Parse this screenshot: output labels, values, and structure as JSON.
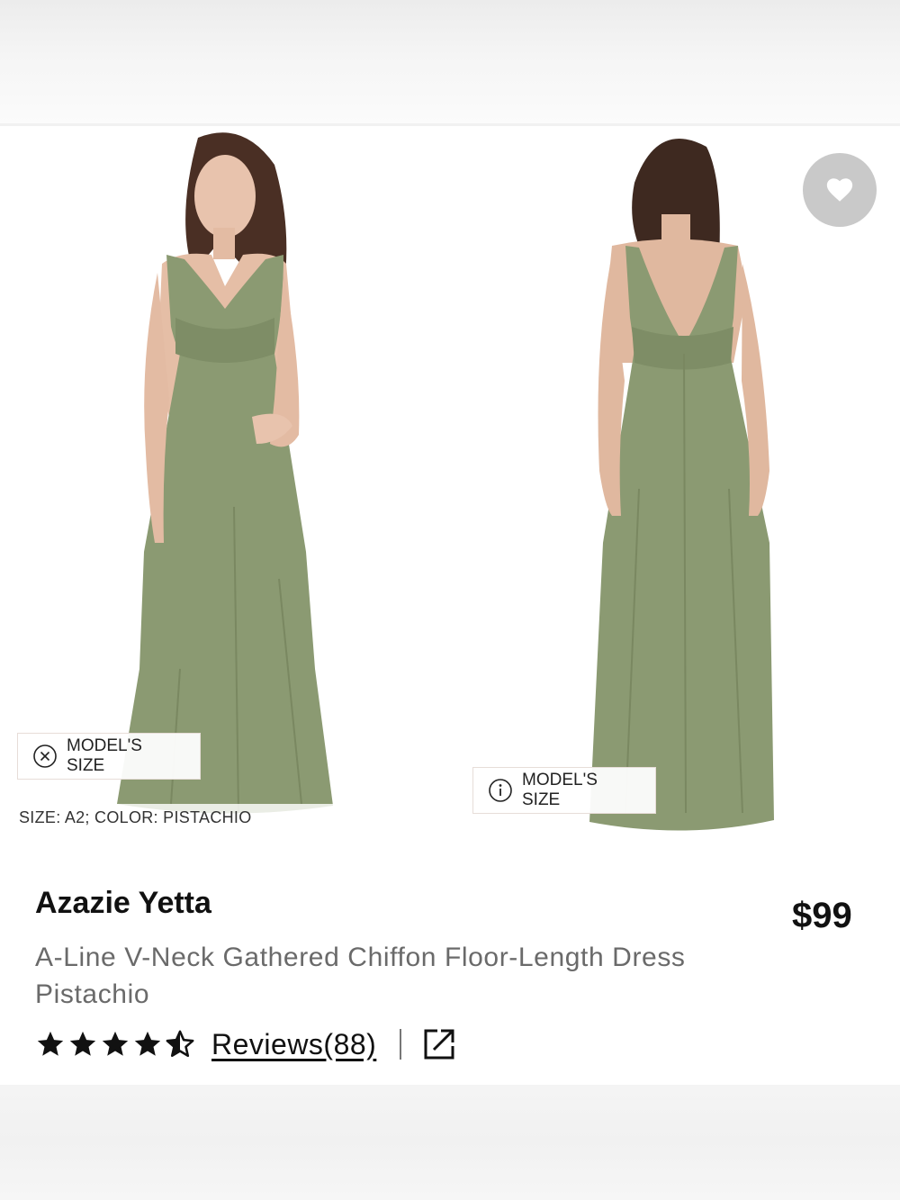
{
  "gallery": {
    "model_size_label_1": "MODEL'S SIZE",
    "model_size_label_2": "MODEL'S SIZE",
    "size_caption": "SIZE: A2; COLOR: PISTACHIO",
    "favorite_icon": "heart-icon",
    "dress_color": "#8b9a72"
  },
  "product": {
    "title": "Azazie Yetta",
    "price": "$99",
    "description": "A-Line V-Neck Gathered Chiffon Floor-Length Dress Pistachio",
    "rating": 4.5,
    "rating_max": 5,
    "reviews_label": "Reviews(88)",
    "share_icon": "external-link-icon"
  }
}
